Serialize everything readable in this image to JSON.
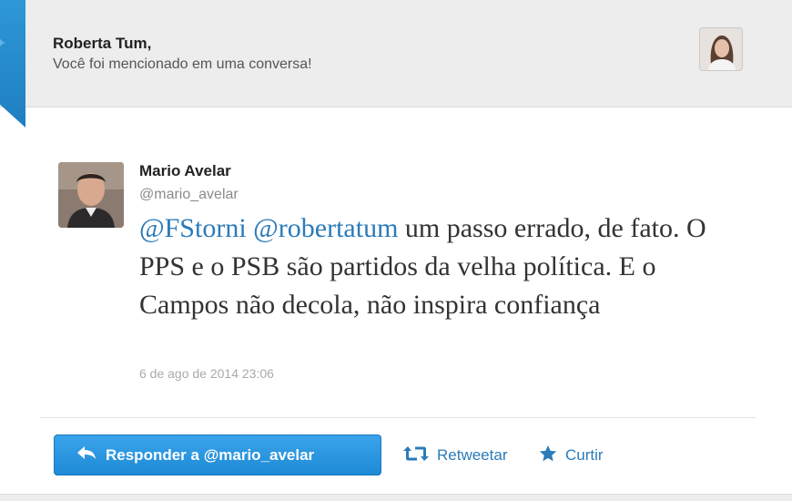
{
  "header": {
    "recipient_name": "Roberta Tum,",
    "notice": "Você foi mencionado em uma conversa!",
    "bird_icon": "twitter-bird-icon"
  },
  "tweet": {
    "author_name": "Mario Avelar",
    "author_handle": "@mario_avelar",
    "mention_1": "@FStorni",
    "mention_2": "@robertatum",
    "text_rest": " um passo errado, de fato. O PPS e o PSB são partidos da velha política. E o Campos não decola, não inspira confiança",
    "timestamp": "6 de ago de 2014 23:06"
  },
  "actions": {
    "reply_label": "Responder a @mario_avelar",
    "retweet_label": "Retweetar",
    "like_label": "Curtir"
  },
  "colors": {
    "accent": "#2b7bb9",
    "button": "#2694dd",
    "header_bg": "#ededed"
  }
}
